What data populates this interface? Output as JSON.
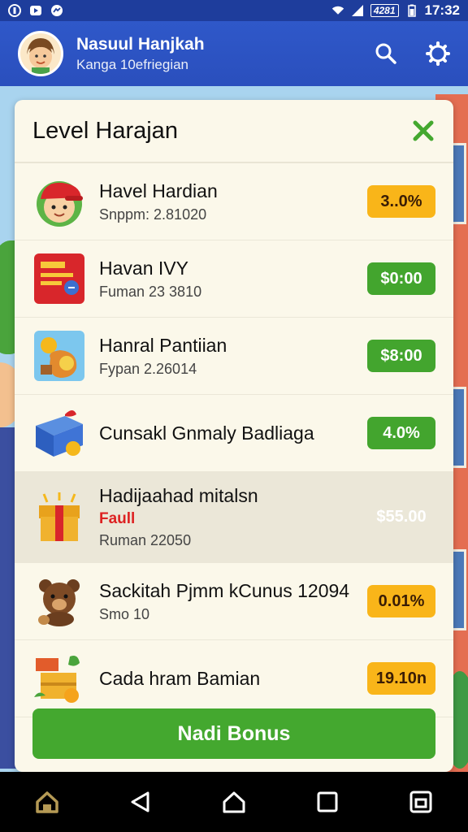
{
  "status_bar": {
    "battery_label": "4281",
    "time": "17:32"
  },
  "header": {
    "user_name": "Nasuul Hanjkah",
    "user_sub": "Kanga 10efriegian"
  },
  "dialog": {
    "title": "Level Harajan",
    "items": [
      {
        "title": "Havel Hardian",
        "sub": "Snppm: 2.81020",
        "badge": "3..0%",
        "badge_color": "orange",
        "icon": "cap-boy-icon"
      },
      {
        "title": "Havan IVY",
        "sub": "Fuman 23 3810",
        "badge": "$0:00",
        "badge_color": "green",
        "icon": "red-card-icon"
      },
      {
        "title": "Hanral Pantiian",
        "sub": "Fypan 2.26014",
        "badge": "$8:00",
        "badge_color": "green",
        "icon": "coin-bag-icon"
      },
      {
        "title": "Cunsakl Gnmaly Badliaga",
        "sub": "",
        "badge": "4.0%",
        "badge_color": "green",
        "icon": "gift-box-icon"
      },
      {
        "title": "Hadijaahad mitalsn",
        "tag": "Faull",
        "sub": "Ruman 22050",
        "badge": "$55.00",
        "badge_color": "ghost",
        "icon": "treasure-box-icon"
      },
      {
        "title": "Sackitah Pjmm kCunus 12094",
        "sub": "Smo    10",
        "badge": "0.01%",
        "badge_color": "orange",
        "icon": "bear-icon"
      },
      {
        "title": "Cada hram Bamian",
        "sub": "",
        "badge": "19.10n",
        "badge_color": "orange",
        "icon": "fruit-crate-icon"
      }
    ],
    "bonus_button": "Nadi Bonus"
  },
  "colors": {
    "primary_blue": "#2f58c9",
    "accent_green": "#44a82f",
    "accent_orange": "#f9b519",
    "dialog_bg": "#fbf8ea"
  }
}
